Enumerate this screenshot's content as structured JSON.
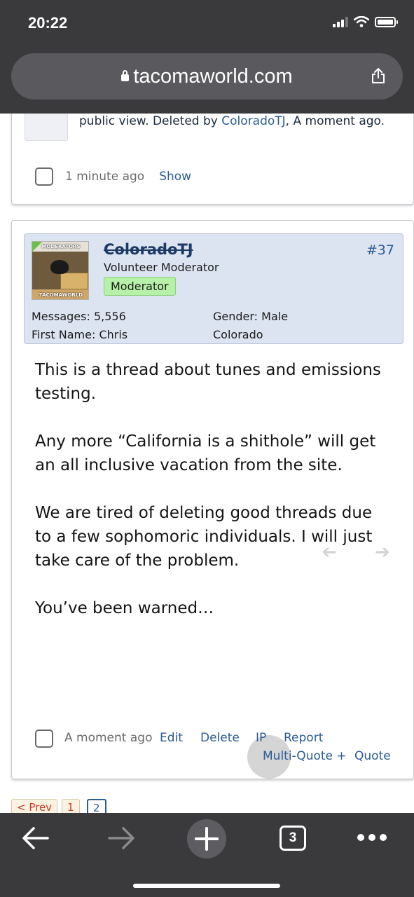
{
  "status_bar": {
    "time": "20:22"
  },
  "browser": {
    "url": "tacomaworld.com",
    "tab_count": "3"
  },
  "deleted_post": {
    "notice_prefix": "public view. Deleted by ",
    "deleted_by": "ColoradoTJ",
    "notice_suffix": ", A moment ago.",
    "time": "1 minute ago",
    "show_label": "Show"
  },
  "post": {
    "username": "ColoradoTJ",
    "user_title": "Volunteer Moderator",
    "badge": "Moderator",
    "post_number": "#37",
    "avatar_top_text": "MODERATORS",
    "avatar_bottom_text": "TACOMAWORLD",
    "stats": {
      "messages_label": "Messages:",
      "messages_value": "5,556",
      "gender_label": "Gender:",
      "gender_value": "Male",
      "first_name_label": "First Name:",
      "first_name_value": "Chris",
      "location": "Colorado"
    },
    "body": [
      "This is a thread about tunes and emissions testing.",
      "Any more “California is a shithole” will get an all inclusive vacation from the site.",
      "We are tired of deleting good threads due to a few sophomoric individuals. I will just take care of the problem.",
      "You’ve been warned…"
    ],
    "time": "A moment ago",
    "actions": {
      "edit": "Edit",
      "delete": "Delete",
      "ip": "IP",
      "report": "Report",
      "multi_quote": "Multi-Quote +",
      "quote": "Quote"
    }
  },
  "pagination": {
    "prev": "< Prev",
    "page1": "1",
    "page2": "2"
  },
  "colors": {
    "chrome": "#3a3a3c",
    "link": "#2b5d96",
    "user_panel": "#dde4f1",
    "badge": "#b7f0a8"
  },
  "icons": [
    "lock-icon",
    "share-icon",
    "back-arrow-icon",
    "forward-arrow-icon",
    "new-tab-plus-icon",
    "tabs-icon",
    "more-dots-icon"
  ]
}
